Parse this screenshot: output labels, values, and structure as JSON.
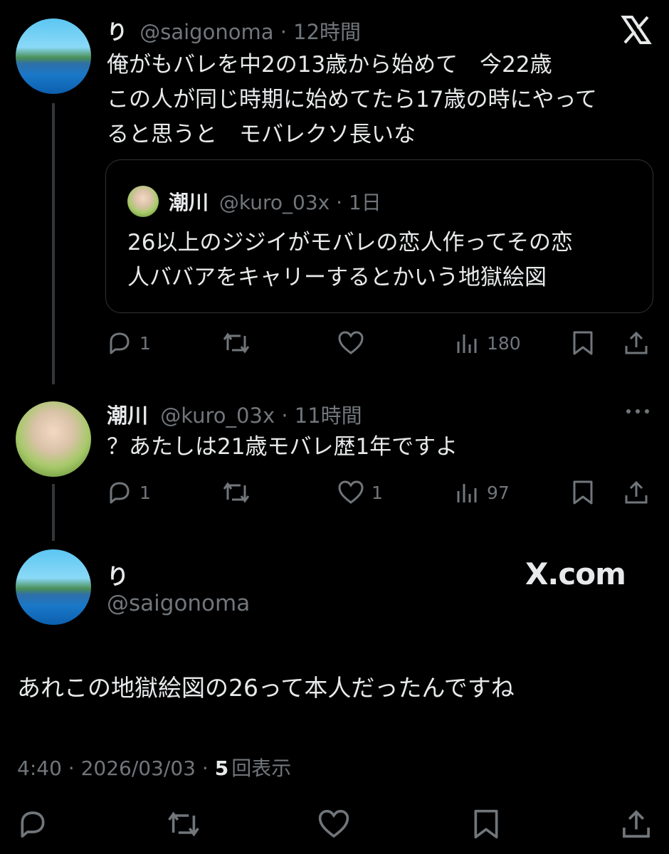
{
  "post1": {
    "name": "り",
    "handle": "@saigonoma",
    "sep": "·",
    "time": "12時間",
    "lines": [
      "俺がもバレを中2の13歳から始めて　今22歳",
      "この人が同じ時期に始めてたら17歳の時にやって",
      "ると思うと　モバレクソ長いな"
    ],
    "quote": {
      "name": "潮川",
      "handle": "@kuro_03x",
      "sep": "·",
      "time": "1日",
      "lines": [
        "26以上のジジイがモバレの恋人作ってその恋",
        "人ババアをキャリーするとかいう地獄絵図"
      ]
    },
    "actions": {
      "replies": "1",
      "retweets": "",
      "likes": "",
      "views": "180"
    }
  },
  "post2": {
    "name": "潮川",
    "handle": "@kuro_03x",
    "sep": "·",
    "time": "11時間",
    "text": "？あたしは21歳モバレ歴1年ですよ",
    "actions": {
      "replies": "1",
      "retweets": "",
      "likes": "1",
      "views": "97"
    }
  },
  "main": {
    "name": "り",
    "handle": "@saigonoma",
    "watermark": "X.com",
    "text": "あれこの地獄絵図の26って本人だったんですね",
    "time": "4:40",
    "dot1": "·",
    "date": "2026/03/03",
    "dot2": "·",
    "views_count": "5",
    "views_label": "回表示"
  },
  "icons": [
    "x-logo-icon",
    "reply-icon",
    "retweet-icon",
    "like-icon",
    "views-icon",
    "bookmark-icon",
    "share-icon",
    "more-icon"
  ]
}
